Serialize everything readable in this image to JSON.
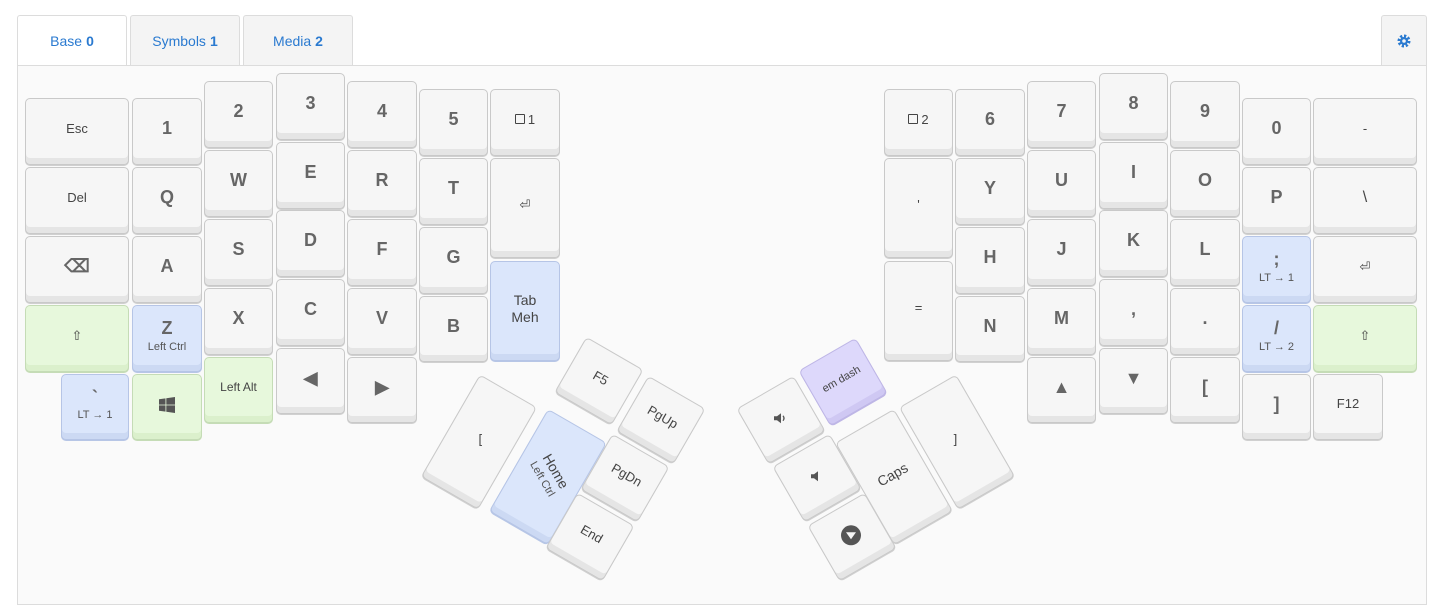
{
  "tabs": [
    {
      "label": "Base",
      "num": "0"
    },
    {
      "label": "Symbols",
      "num": "1"
    },
    {
      "label": "Media",
      "num": "2"
    }
  ],
  "left": {
    "esc": "Esc",
    "del": "Del",
    "backspace": "⌫",
    "shift": "⇧",
    "grave": "`",
    "grave_sub": "LT → 1",
    "n1": "1",
    "q": "Q",
    "a": "A",
    "z": "Z",
    "z_sub": "Left Ctrl",
    "n2": "2",
    "w": "W",
    "s": "S",
    "x": "X",
    "left_alt": "Left Alt",
    "n3": "3",
    "e": "E",
    "d": "D",
    "c": "C",
    "left_arrow": "◀",
    "n4": "4",
    "r": "R",
    "f": "F",
    "v": "V",
    "right_arrow": "▶",
    "n5": "5",
    "t": "T",
    "g": "G",
    "b": "B",
    "layer1": "1",
    "enter": "⏎",
    "tab_meh": [
      "Tab",
      "Meh"
    ]
  },
  "left_thumb": {
    "bracket": "[",
    "home": "Home",
    "home_sub": "Left Ctrl",
    "f5": "F5",
    "pgup": "PgUp",
    "pgdn": "PgDn",
    "end": "End"
  },
  "right": {
    "layer2": "2",
    "quote": "'",
    "equals": "=",
    "n6": "6",
    "y": "Y",
    "h": "H",
    "n": "N",
    "n7": "7",
    "u": "U",
    "j": "J",
    "m": "M",
    "up": "▲",
    "n8": "8",
    "i": "I",
    "k": "K",
    "comma": ",",
    "down": "▼",
    "n9": "9",
    "o": "O",
    "l": "L",
    "period": ".",
    "lbracket": "[",
    "n0": "0",
    "p": "P",
    "semicolon": ";",
    "semi_sub": "LT → 1",
    "slash": "/",
    "slash_sub": "LT → 2",
    "rbracket": "]",
    "minus": "-",
    "backslash": "\\",
    "enter": "⏎",
    "shift": "⇧",
    "f12": "F12"
  },
  "right_thumb": {
    "em_dash": "em dash",
    "caps": "Caps",
    "bracket": "]"
  },
  "colors": {
    "accent": "#2a7ad0",
    "blue_key": "#dbe6fb",
    "green_key": "#e7f8dc",
    "purple_key": "#ddd8fb"
  }
}
